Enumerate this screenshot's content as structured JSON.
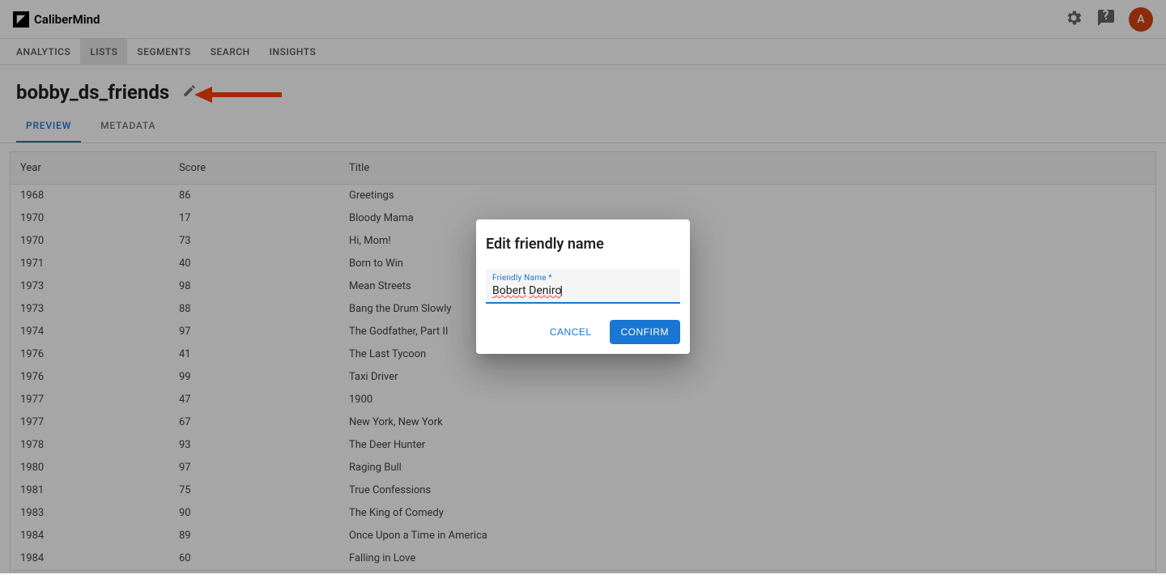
{
  "header": {
    "brand": "CaliberMind",
    "avatar_letter": "A"
  },
  "nav": {
    "tabs": [
      "ANALYTICS",
      "LISTS",
      "SEGMENTS",
      "SEARCH",
      "INSIGHTS"
    ],
    "active": "LISTS"
  },
  "page": {
    "title": "bobby_ds_friends",
    "subtabs": [
      "PREVIEW",
      "METADATA"
    ],
    "active_subtab": "PREVIEW"
  },
  "table": {
    "columns": [
      "Year",
      "Score",
      "Title"
    ],
    "rows": [
      [
        "1968",
        "86",
        "Greetings"
      ],
      [
        "1970",
        "17",
        "Bloody Mama"
      ],
      [
        "1970",
        "73",
        "Hi, Mom!"
      ],
      [
        "1971",
        "40",
        "Born to Win"
      ],
      [
        "1973",
        "98",
        "Mean Streets"
      ],
      [
        "1973",
        "88",
        "Bang the Drum Slowly"
      ],
      [
        "1974",
        "97",
        "The Godfather, Part II"
      ],
      [
        "1976",
        "41",
        "The Last Tycoon"
      ],
      [
        "1976",
        "99",
        "Taxi Driver"
      ],
      [
        "1977",
        "47",
        "1900"
      ],
      [
        "1977",
        "67",
        "New York, New York"
      ],
      [
        "1978",
        "93",
        "The Deer Hunter"
      ],
      [
        "1980",
        "97",
        "Raging Bull"
      ],
      [
        "1981",
        "75",
        "True Confessions"
      ],
      [
        "1983",
        "90",
        "The King of Comedy"
      ],
      [
        "1984",
        "89",
        "Once Upon a Time in America"
      ],
      [
        "1984",
        "60",
        "Falling in Love"
      ]
    ]
  },
  "modal": {
    "title": "Edit friendly name",
    "field_label": "Friendly Name *",
    "field_value": "Bobert Deniro",
    "cancel": "CANCEL",
    "confirm": "CONFIRM"
  }
}
